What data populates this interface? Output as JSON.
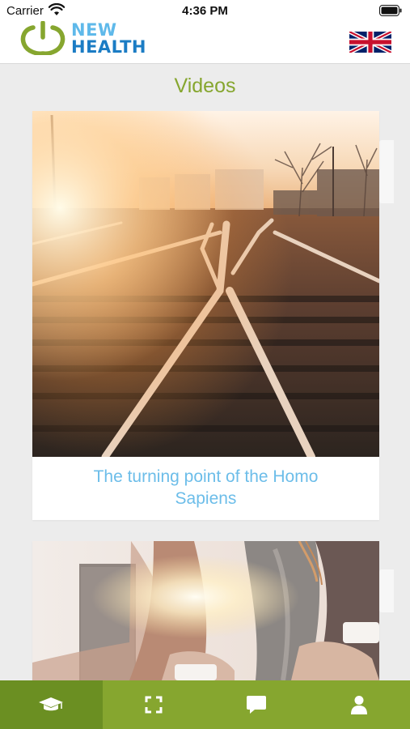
{
  "status_bar": {
    "carrier": "Carrier",
    "time": "4:36 PM"
  },
  "header": {
    "logo_line1": "NEW",
    "logo_line2": "HEALTH",
    "language_icon": "uk-flag-icon"
  },
  "page": {
    "title": "Videos"
  },
  "videos": [
    {
      "caption": "The turning point of the Homo Sapiens",
      "thumbnail": "railway-tracks-sunset"
    },
    {
      "caption": "",
      "thumbnail": "person-tying-shoe-sunlight"
    }
  ],
  "tabs": [
    {
      "icon": "graduation-cap-icon",
      "active": true
    },
    {
      "icon": "fullscreen-icon",
      "active": false
    },
    {
      "icon": "chat-bubble-icon",
      "active": false
    },
    {
      "icon": "user-icon",
      "active": false
    }
  ],
  "colors": {
    "accent": "#86a62f",
    "accent_dark": "#6b8f22",
    "caption": "#6cbde9",
    "logo_light": "#5fb9ea",
    "logo_dark": "#1b7cc4"
  }
}
